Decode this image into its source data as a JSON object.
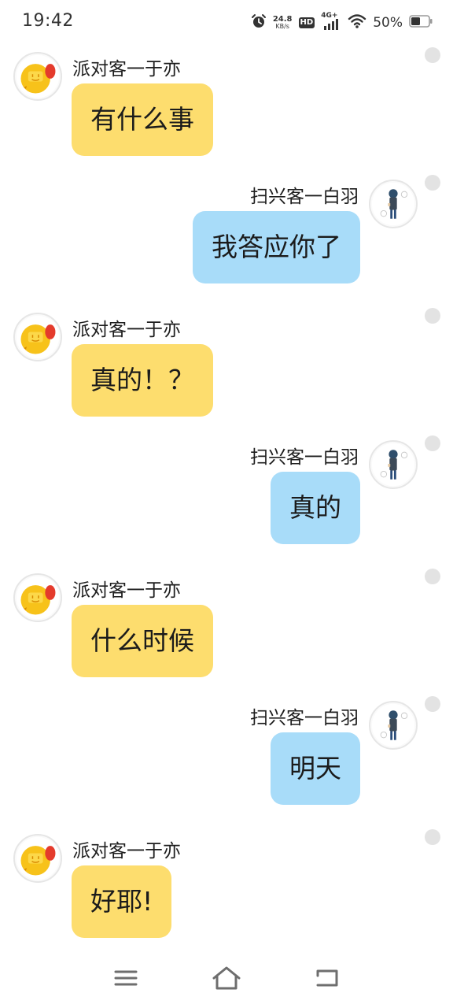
{
  "status_bar": {
    "time": "19:42",
    "net_speed_value": "24.8",
    "net_speed_unit": "KB/s",
    "hd_label": "HD",
    "network_label": "4G+",
    "battery_percent": "50%",
    "icons": [
      "alarm-icon",
      "hd-icon",
      "cellular-signal-icon",
      "wifi-icon",
      "battery-icon"
    ]
  },
  "contacts": {
    "other": {
      "name": "派对客一于亦",
      "avatar_icon": "yellow-character-avatar",
      "bubble_color": "#fddd6e"
    },
    "self": {
      "name": "扫兴客一白羽",
      "avatar_icon": "anime-character-avatar",
      "bubble_color": "#a8dcf9"
    }
  },
  "messages": [
    {
      "side": "left",
      "sender": "派对客一于亦",
      "text": "有什么事"
    },
    {
      "side": "right",
      "sender": "扫兴客一白羽",
      "text": "我答应你了"
    },
    {
      "side": "left",
      "sender": "派对客一于亦",
      "text": "真的！？"
    },
    {
      "side": "right",
      "sender": "扫兴客一白羽",
      "text": "真的"
    },
    {
      "side": "left",
      "sender": "派对客一于亦",
      "text": "什么时候"
    },
    {
      "side": "right",
      "sender": "扫兴客一白羽",
      "text": "明天"
    },
    {
      "side": "left",
      "sender": "派对客一于亦",
      "text": "好耶!"
    }
  ],
  "nav_bar": {
    "icons": [
      "menu-icon",
      "home-icon",
      "back-icon"
    ]
  }
}
